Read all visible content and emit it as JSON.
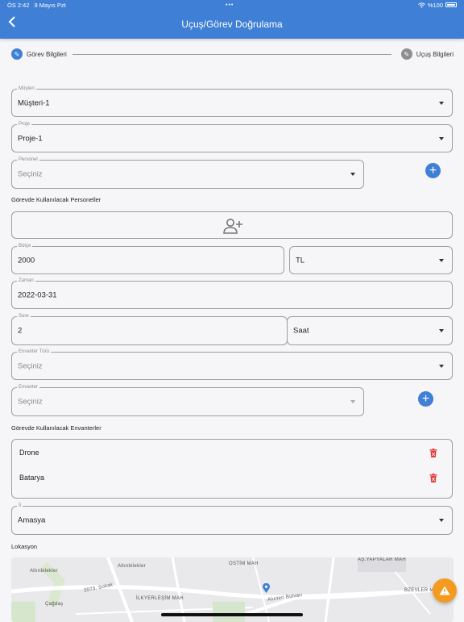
{
  "status_bar": {
    "time": "ÖS 2:42",
    "date": "9 Mayıs Pzt",
    "battery": "%100"
  },
  "header": {
    "title": "Uçuş/Görev Doğrulama"
  },
  "stepper": {
    "step1": "Görev Bilgileri",
    "step2": "Uçuş Bilgileri"
  },
  "form": {
    "musteri": {
      "label": "Müşteri",
      "value": "Müşteri-1"
    },
    "proje": {
      "label": "Proje",
      "value": "Proje-1"
    },
    "personel": {
      "label": "Personel",
      "placeholder": "Seçiniz"
    },
    "personeller_title": "Görevde Kullanılacak Personeller",
    "butce": {
      "label": "Bütçe",
      "value": "2000"
    },
    "currency": {
      "value": "TL"
    },
    "zaman": {
      "label": "Zaman",
      "value": "2022-03-31"
    },
    "sure": {
      "label": "Sure",
      "value": "2"
    },
    "sure_unit": {
      "value": "Saat"
    },
    "envanter_turu": {
      "label": "Envanter Türü",
      "placeholder": "Seçiniz"
    },
    "envanter": {
      "label": "Envanter",
      "placeholder": "Seçiniz"
    },
    "envanterler_title": "Görevde Kullanılacak Envanterler",
    "envanterler": [
      "Drone",
      "Batarya"
    ],
    "il": {
      "label": "İl",
      "value": "Amasya"
    },
    "lokasyon_title": "Lokasyon"
  },
  "map": {
    "labels": [
      "Altınbilekler",
      "Altınbilekler",
      "OSTİM MAH",
      "AŞ.YAPYALAR MAH",
      "2073. Sokak",
      "İLKYERLEŞİM MAH",
      "Alınteri Bulvarı",
      "BZEVLER MAH",
      "Çağdaş"
    ]
  },
  "colors": {
    "primary": "#3f7fd6",
    "danger": "#e53935",
    "fab": "#f49b1f"
  }
}
